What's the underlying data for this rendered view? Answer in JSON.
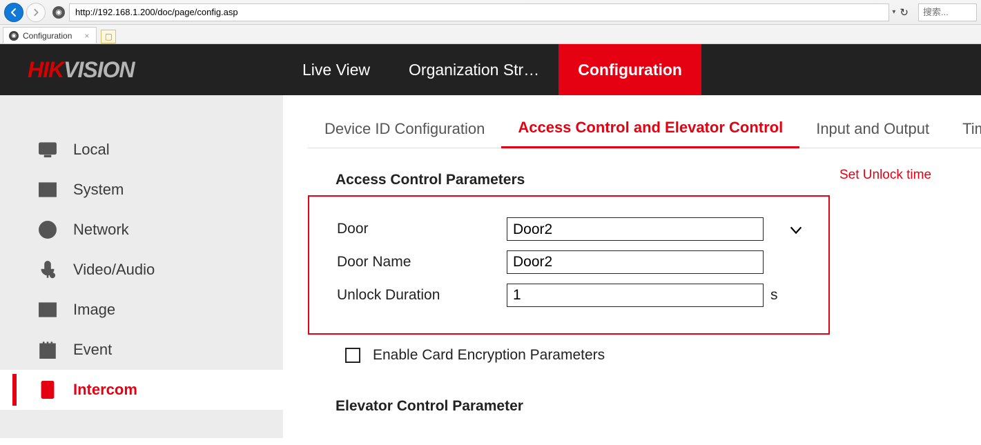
{
  "browser": {
    "url": "http://192.168.1.200/doc/page/config.asp",
    "search_placeholder": "搜索...",
    "tab_title": "Configuration"
  },
  "logo": {
    "part1": "HIK",
    "part2": "VISION"
  },
  "topnav": {
    "live": "Live View",
    "org": "Organization Str…",
    "config": "Configuration"
  },
  "sidebar": {
    "local": "Local",
    "system": "System",
    "network": "Network",
    "video": "Video/Audio",
    "image": "Image",
    "event": "Event",
    "intercom": "Intercom"
  },
  "subtabs": {
    "device_id": "Device ID Configuration",
    "access": "Access Control and Elevator Control",
    "io": "Input and Output",
    "time": "Tim"
  },
  "panel": {
    "section1_title": "Access Control Parameters",
    "door_label": "Door",
    "door_value": "Door2",
    "door_name_label": "Door Name",
    "door_name_value": "Door2",
    "unlock_label": "Unlock Duration",
    "unlock_value": "1",
    "unlock_unit": "s",
    "annotation": "Set Unlock time",
    "checkbox_label": "Enable Card Encryption Parameters",
    "section2_title": "Elevator Control Parameter"
  }
}
